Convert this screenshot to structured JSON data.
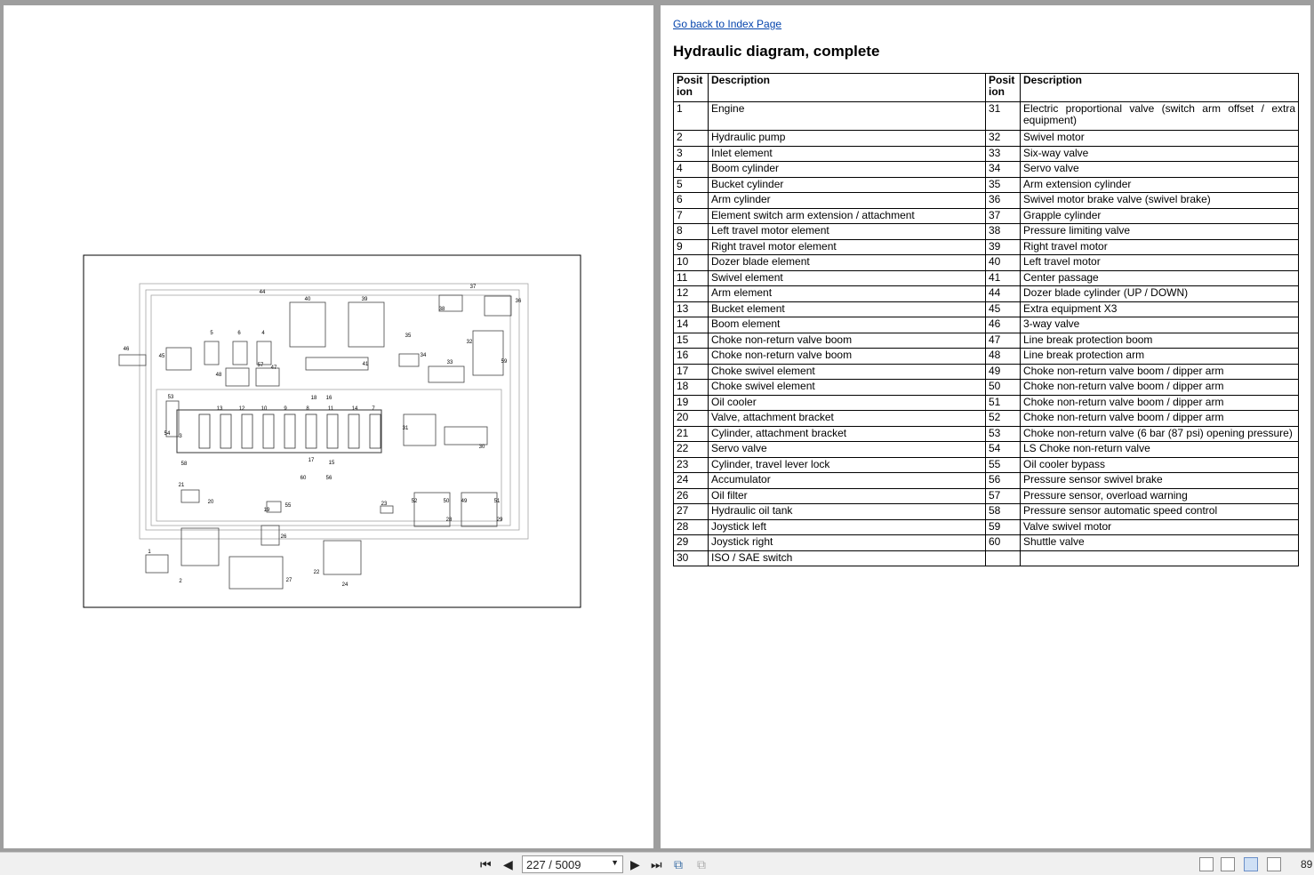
{
  "document": {
    "link": "Go back to Index Page",
    "title": "Hydraulic diagram, complete",
    "headers": [
      "Posit ion",
      "Description",
      "Posit ion",
      "Description"
    ],
    "rows": [
      [
        "1",
        "Engine",
        "31",
        "Electric proportional valve (switch arm offset / extra equipment)"
      ],
      [
        "2",
        "Hydraulic pump",
        "32",
        "Swivel motor"
      ],
      [
        "3",
        "Inlet element",
        "33",
        "Six-way valve"
      ],
      [
        "4",
        "Boom cylinder",
        "34",
        "Servo valve"
      ],
      [
        "5",
        "Bucket cylinder",
        "35",
        "Arm extension cylinder"
      ],
      [
        "6",
        "Arm cylinder",
        "36",
        "Swivel motor brake valve (swivel brake)"
      ],
      [
        "7",
        "Element switch arm extension / attachment",
        "37",
        "Grapple cylinder"
      ],
      [
        "8",
        "Left travel motor element",
        "38",
        "Pressure limiting valve"
      ],
      [
        "9",
        "Right travel motor element",
        "39",
        "Right travel motor"
      ],
      [
        "10",
        "Dozer blade element",
        "40",
        "Left travel motor"
      ],
      [
        "11",
        "Swivel element",
        "41",
        "Center passage"
      ],
      [
        "12",
        "Arm element",
        "44",
        "Dozer blade cylinder (UP / DOWN)"
      ],
      [
        "13",
        "Bucket element",
        "45",
        "Extra equipment X3"
      ],
      [
        "14",
        "Boom element",
        "46",
        "3-way valve"
      ],
      [
        "15",
        "Choke non-return valve boom",
        "47",
        "Line break protection boom"
      ],
      [
        "16",
        "Choke non-return valve boom",
        "48",
        "Line break protection arm"
      ],
      [
        "17",
        "Choke swivel element",
        "49",
        "Choke non-return valve boom / dipper arm"
      ],
      [
        "18",
        "Choke swivel element",
        "50",
        "Choke non-return valve boom / dipper arm"
      ],
      [
        "19",
        "Oil cooler",
        "51",
        "Choke non-return valve boom / dipper arm"
      ],
      [
        "20",
        "Valve, attachment bracket",
        "52",
        "Choke non-return valve boom / dipper arm"
      ],
      [
        "21",
        "Cylinder, attachment bracket",
        "53",
        "Choke non-return valve (6 bar (87 psi) opening pressure)"
      ],
      [
        "22",
        "Servo valve",
        "54",
        "LS Choke non-return valve"
      ],
      [
        "23",
        "Cylinder, travel lever lock",
        "55",
        "Oil cooler bypass"
      ],
      [
        "24",
        "Accumulator",
        "56",
        "Pressure sensor swivel brake"
      ],
      [
        "26",
        "Oil filter",
        "57",
        "Pressure sensor, overload warning"
      ],
      [
        "27",
        "Hydraulic oil tank",
        "58",
        "Pressure sensor automatic speed control"
      ],
      [
        "28",
        "Joystick left",
        "59",
        "Valve swivel motor"
      ],
      [
        "29",
        "Joystick right",
        "60",
        "Shuttle valve"
      ],
      [
        "30",
        "ISO / SAE switch",
        "",
        ""
      ]
    ]
  },
  "diagram": {
    "labels": [
      "44",
      "40",
      "39",
      "37",
      "38",
      "36",
      "46",
      "45",
      "5",
      "6",
      "4",
      "47",
      "57",
      "48",
      "41",
      "35",
      "34",
      "33",
      "32",
      "59",
      "53",
      "13",
      "12",
      "10",
      "9",
      "8",
      "11",
      "14",
      "7",
      "18",
      "16",
      "54",
      "3",
      "31",
      "30",
      "58",
      "17",
      "15",
      "60",
      "56",
      "21",
      "20",
      "19",
      "55",
      "23",
      "52",
      "50",
      "49",
      "51",
      "28",
      "29",
      "1",
      "26",
      "2",
      "22",
      "24",
      "27"
    ]
  },
  "toolbar": {
    "page_input": "227 / 5009",
    "zoom": "89"
  }
}
